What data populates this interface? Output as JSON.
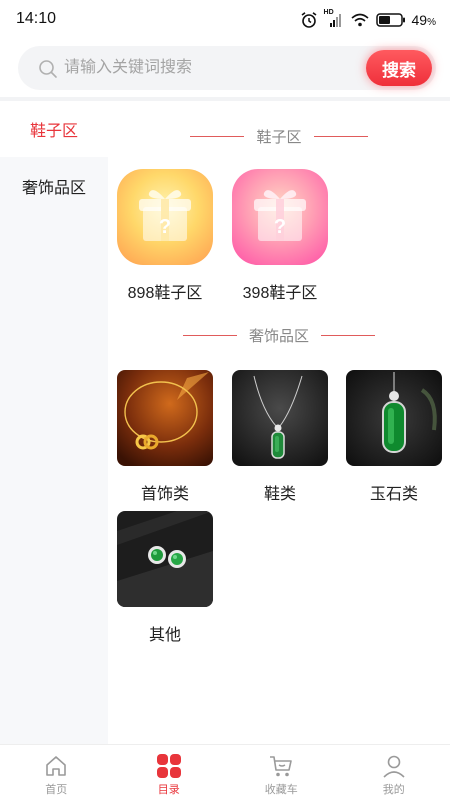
{
  "status_bar": {
    "time": "14:10",
    "battery_percent": "49",
    "battery_unit": "%",
    "network_badge": "HD"
  },
  "search": {
    "placeholder": "请输入关键词搜索",
    "button_label": "搜索"
  },
  "sidebar": {
    "items": [
      {
        "label": "鞋子区",
        "active": true
      },
      {
        "label": "奢饰品区",
        "active": false
      }
    ]
  },
  "sections": [
    {
      "title": "鞋子区",
      "items": [
        {
          "label": "898鞋子区",
          "icon": "gift-box-icon"
        },
        {
          "label": "398鞋子区",
          "icon": "gift-box-icon"
        }
      ]
    },
    {
      "title": "奢饰品区",
      "items": [
        {
          "label": "首饰类"
        },
        {
          "label": "鞋类"
        },
        {
          "label": "玉石类"
        },
        {
          "label": "其他"
        }
      ]
    }
  ],
  "tab_bar": {
    "items": [
      {
        "label": "首页",
        "icon": "home-icon",
        "active": false
      },
      {
        "label": "目录",
        "icon": "category-grid-icon",
        "active": true
      },
      {
        "label": "收藏车",
        "icon": "cart-icon",
        "active": false
      },
      {
        "label": "我的",
        "icon": "user-icon",
        "active": false
      }
    ]
  },
  "colors": {
    "accent": "#e8353b",
    "sidebar_bg": "#f7f8fa",
    "search_bg": "#f3f4f6",
    "muted_text": "#888888"
  }
}
